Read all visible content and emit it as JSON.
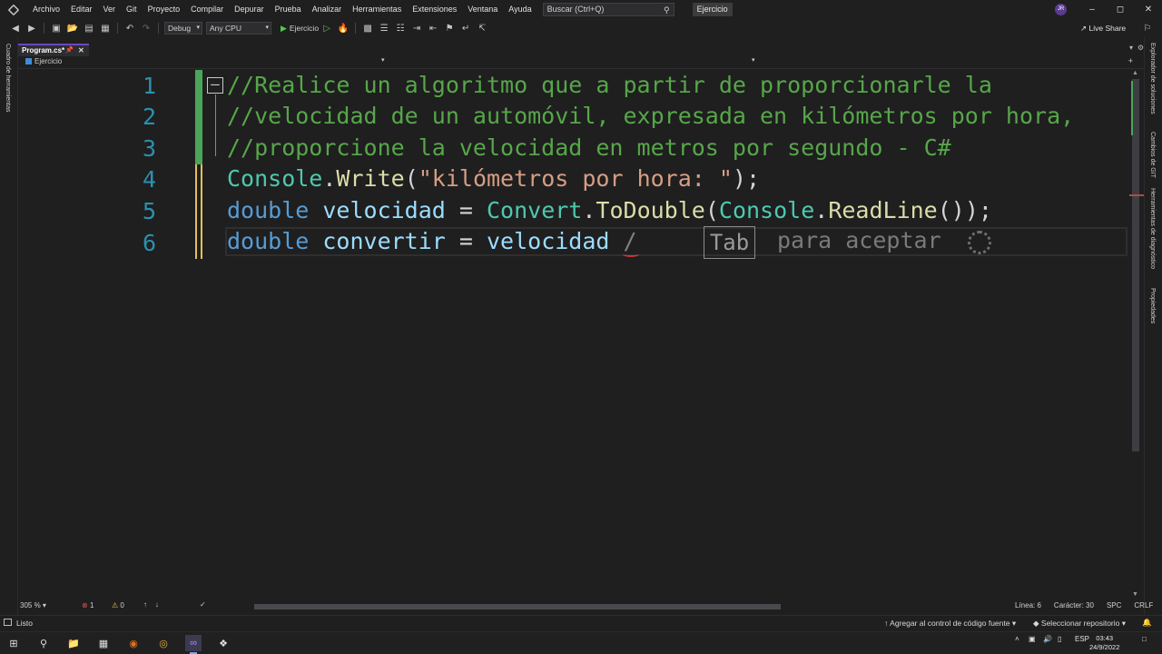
{
  "menu": {
    "items": [
      "Archivo",
      "Editar",
      "Ver",
      "Git",
      "Proyecto",
      "Compilar",
      "Depurar",
      "Prueba",
      "Analizar",
      "Herramientas",
      "Extensiones",
      "Ventana",
      "Ayuda"
    ],
    "search_placeholder": "Buscar (Ctrl+Q)",
    "solution_name": "Ejercicio",
    "user_initials": "JR"
  },
  "toolbar": {
    "config": "Debug",
    "platform": "Any CPU",
    "run_label": "Ejercicio",
    "live_share": "Live Share"
  },
  "left_panel": {
    "toolbox": "Cuadro de herramientas"
  },
  "right_panel": {
    "solution_explorer": "Explorador de soluciones",
    "git_changes": "Cambios de GIT",
    "diagnostics": "Herramientas de diagnóstico",
    "properties": "Propiedades"
  },
  "tab": {
    "file": "Program.cs*"
  },
  "navbar": {
    "project": "Ejercicio"
  },
  "editor": {
    "line_numbers": [
      "1",
      "2",
      "3",
      "4",
      "5",
      "6"
    ],
    "line1": "//Realice un algoritmo que a partir de proporcionarle la",
    "line2": "//velocidad de un automóvil, expresada en kilómetros por hora,",
    "line3": "//proporcione la velocidad en metros por segundo - C#",
    "line4": {
      "cls": "Console",
      "dot": ".",
      "mth": "Write",
      "open": "(",
      "str": "\"kilómetros por hora: \"",
      "close": ");"
    },
    "line5": {
      "kw": "double",
      "id": "velocidad",
      "eq": " = ",
      "cls1": "Convert",
      "dot1": ".",
      "mth1": "ToDouble",
      "open1": "(",
      "cls2": "Console",
      "dot2": ".",
      "mth2": "ReadLine",
      "rest": "());"
    },
    "line6": {
      "kw": "double",
      "id1": "convertir",
      "eq": " = ",
      "id2": "velocidad",
      "ghost": " /"
    },
    "tab_hint": "Tab",
    "accept_hint": "para aceptar"
  },
  "bottom": {
    "zoom": "305 %",
    "errors": "1",
    "warnings": "0",
    "line": "Línea: 6",
    "char": "Carácter: 30",
    "spc": "SPC",
    "crlf": "CRLF"
  },
  "status": {
    "ready": "Listo",
    "source_control": "Agregar al control de código fuente",
    "repo": "Seleccionar repositorio"
  },
  "taskbar": {
    "lang": "ESP",
    "time": "03:43",
    "date": "24/9/2022"
  },
  "colors": {
    "accent": "#6d45c2",
    "comment": "#57a64a",
    "keyword": "#569cd6",
    "class": "#4ec9b0",
    "method": "#dcdcaa",
    "string": "#d69d85",
    "identifier": "#9cdcfe"
  }
}
